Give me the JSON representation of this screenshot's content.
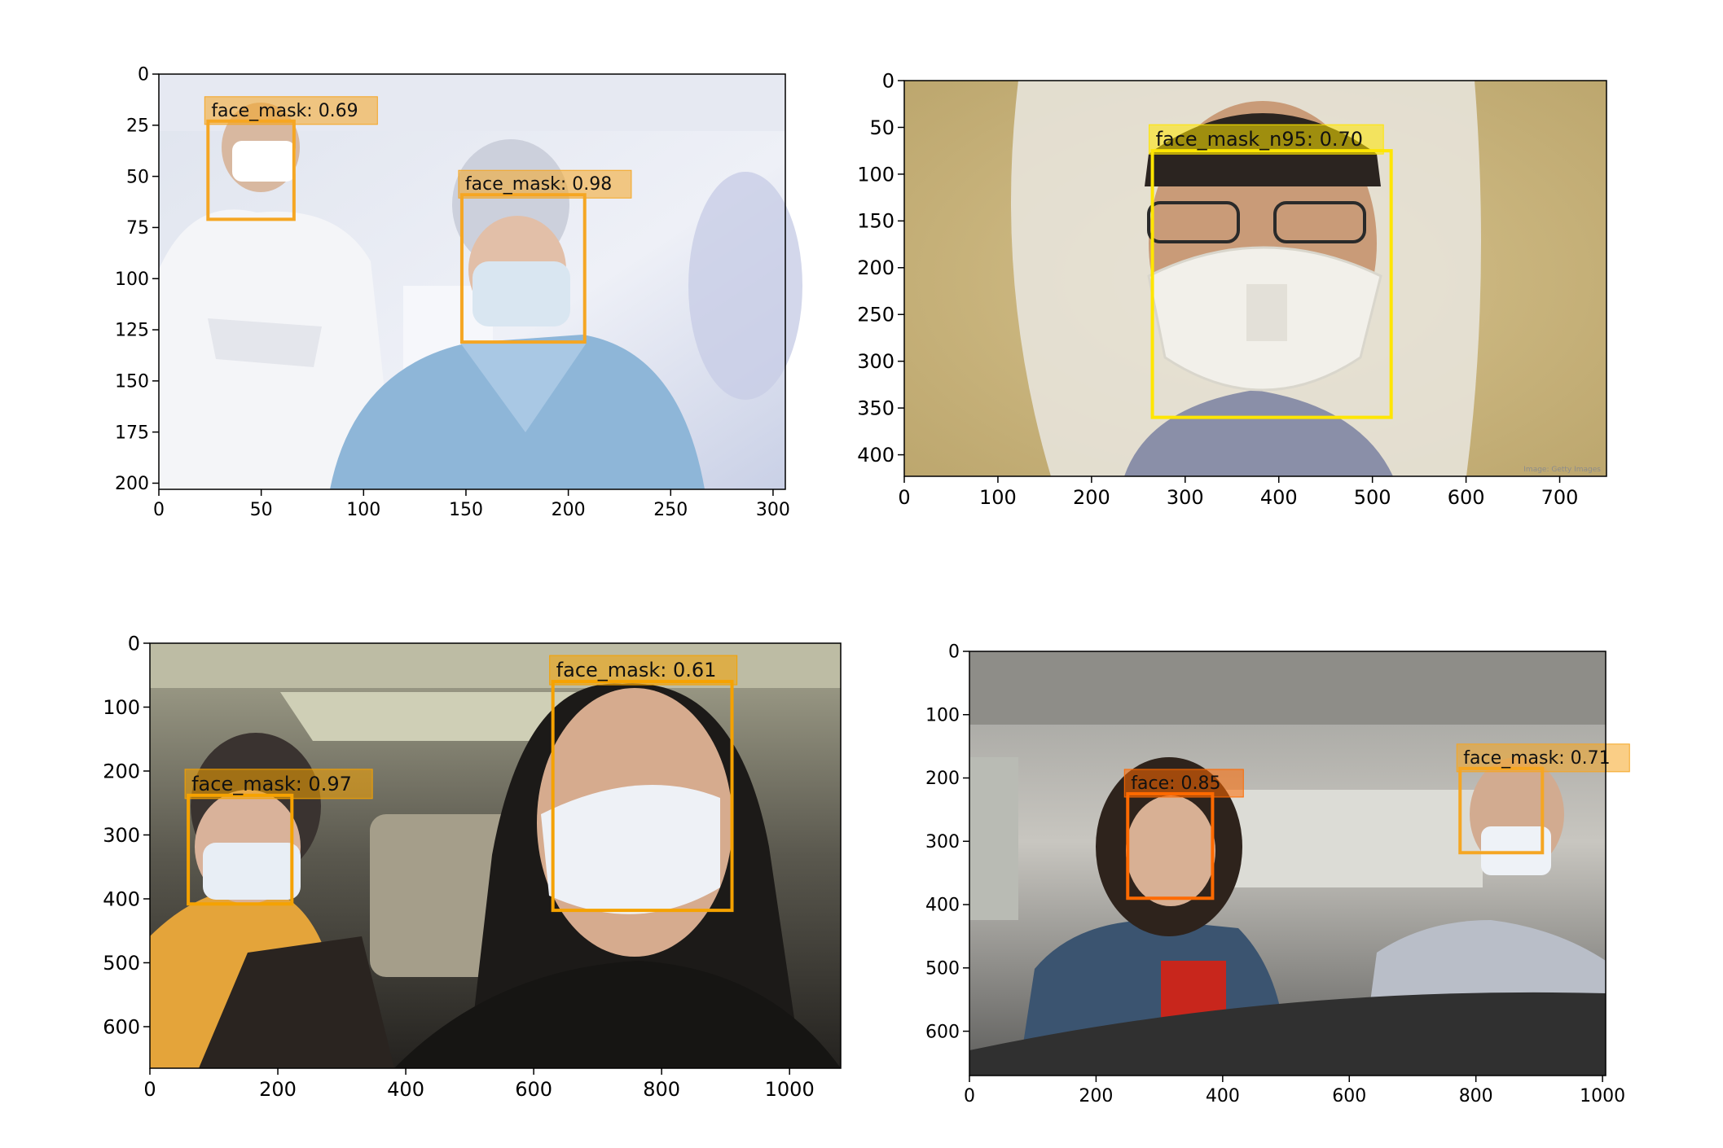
{
  "panels": [
    {
      "id": "top-left",
      "img_w": 306,
      "img_h": 203,
      "xticks": [
        0,
        50,
        100,
        150,
        200,
        250,
        300
      ],
      "yticks": [
        0,
        25,
        50,
        75,
        100,
        125,
        150,
        175,
        200
      ],
      "scene": "lab",
      "detections": [
        {
          "label": "face_mask: 0.69",
          "x1": 24,
          "y1": 23,
          "x2": 66,
          "y2": 71,
          "color": "#f5a623"
        },
        {
          "label": "face_mask: 0.98",
          "x1": 148,
          "y1": 59,
          "x2": 208,
          "y2": 131,
          "color": "#f5a623"
        }
      ]
    },
    {
      "id": "top-right",
      "img_w": 750,
      "img_h": 423,
      "xticks": [
        0,
        100,
        200,
        300,
        400,
        500,
        600,
        700
      ],
      "yticks": [
        0,
        50,
        100,
        150,
        200,
        250,
        300,
        350,
        400
      ],
      "scene": "hood",
      "watermark": "Image: Getty Images",
      "detections": [
        {
          "label": "face_mask_n95: 0.70",
          "x1": 265,
          "y1": 75,
          "x2": 520,
          "y2": 360,
          "color": "#ffe600"
        }
      ]
    },
    {
      "id": "bottom-left",
      "img_w": 1080,
      "img_h": 665,
      "xticks": [
        0,
        200,
        400,
        600,
        800,
        1000
      ],
      "yticks": [
        0,
        100,
        200,
        300,
        400,
        500,
        600
      ],
      "scene": "car-dark",
      "detections": [
        {
          "label": "face_mask: 0.97",
          "x1": 60,
          "y1": 238,
          "x2": 222,
          "y2": 408,
          "color": "#f5a200"
        },
        {
          "label": "face_mask: 0.61",
          "x1": 630,
          "y1": 60,
          "x2": 910,
          "y2": 418,
          "color": "#f5a200"
        }
      ]
    },
    {
      "id": "bottom-right",
      "img_w": 1005,
      "img_h": 670,
      "xticks": [
        0,
        200,
        400,
        600,
        800,
        1000
      ],
      "yticks": [
        0,
        100,
        200,
        300,
        400,
        500,
        600
      ],
      "scene": "car-day",
      "detections": [
        {
          "label": "face: 0.85",
          "x1": 250,
          "y1": 225,
          "x2": 384,
          "y2": 390,
          "color": "#ff6a00"
        },
        {
          "label": "face_mask: 0.71",
          "x1": 775,
          "y1": 185,
          "x2": 905,
          "y2": 318,
          "color": "#f5a623"
        }
      ]
    }
  ]
}
